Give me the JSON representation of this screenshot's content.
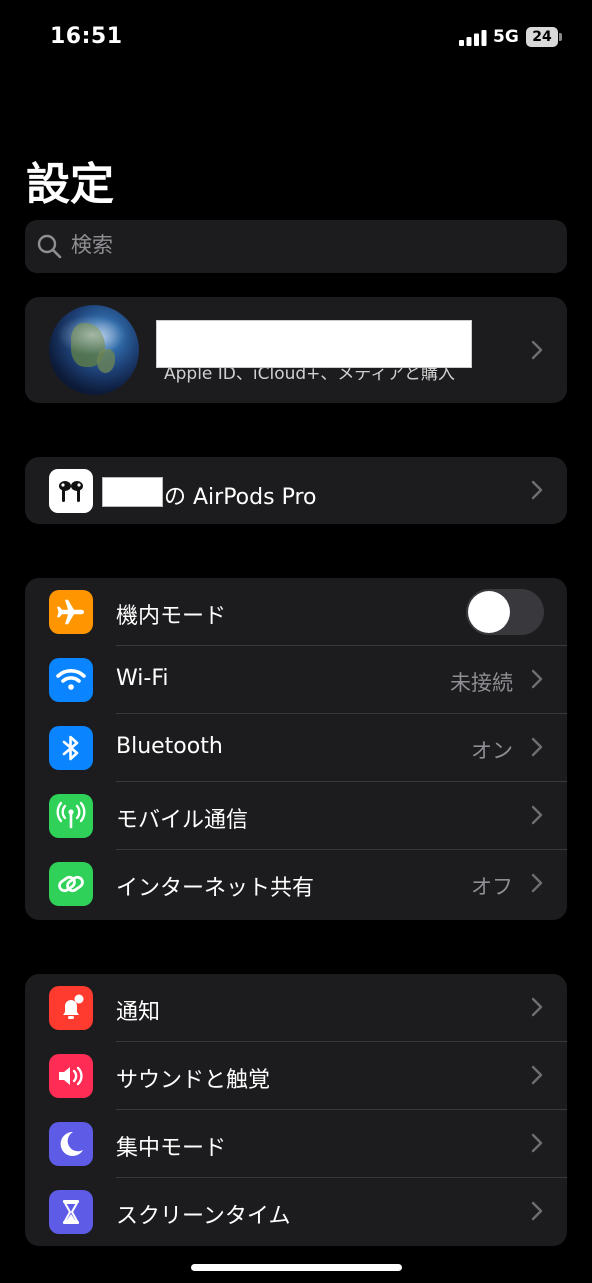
{
  "status_bar": {
    "time": "16:51",
    "network": "5G",
    "battery_level": "24",
    "icons": [
      "signal-icon",
      "battery-icon"
    ]
  },
  "page_title": "設定",
  "search": {
    "placeholder": "検索",
    "icon": "search-icon"
  },
  "profile": {
    "subtitle": "Apple ID、iCloud+、メディアと購入",
    "icon": "avatar"
  },
  "airpods": {
    "label": "の AirPods Pro",
    "icon": "airpods-icon"
  },
  "connectivity": [
    {
      "label": "機内モード",
      "value": "",
      "control": "toggle",
      "toggle_on": false,
      "icon": "airplane-icon",
      "color": "#ff9500"
    },
    {
      "label": "Wi-Fi",
      "value": "未接続",
      "control": "chevron",
      "icon": "wifi-icon",
      "color": "#0a84ff"
    },
    {
      "label": "Bluetooth",
      "value": "オン",
      "control": "chevron",
      "icon": "bluetooth-icon",
      "color": "#0a84ff"
    },
    {
      "label": "モバイル通信",
      "value": "",
      "control": "chevron",
      "icon": "antenna-icon",
      "color": "#30d158"
    },
    {
      "label": "インターネット共有",
      "value": "オフ",
      "control": "chevron",
      "icon": "hotspot-icon",
      "color": "#30d158"
    }
  ],
  "notifications_group": [
    {
      "label": "通知",
      "icon": "bell-icon",
      "color": "#ff3b30"
    },
    {
      "label": "サウンドと触覚",
      "icon": "speaker-icon",
      "color": "#ff2d55"
    },
    {
      "label": "集中モード",
      "icon": "moon-icon",
      "color": "#5e5ce6"
    },
    {
      "label": "スクリーンタイム",
      "icon": "hourglass-icon",
      "color": "#5e5ce6"
    }
  ]
}
